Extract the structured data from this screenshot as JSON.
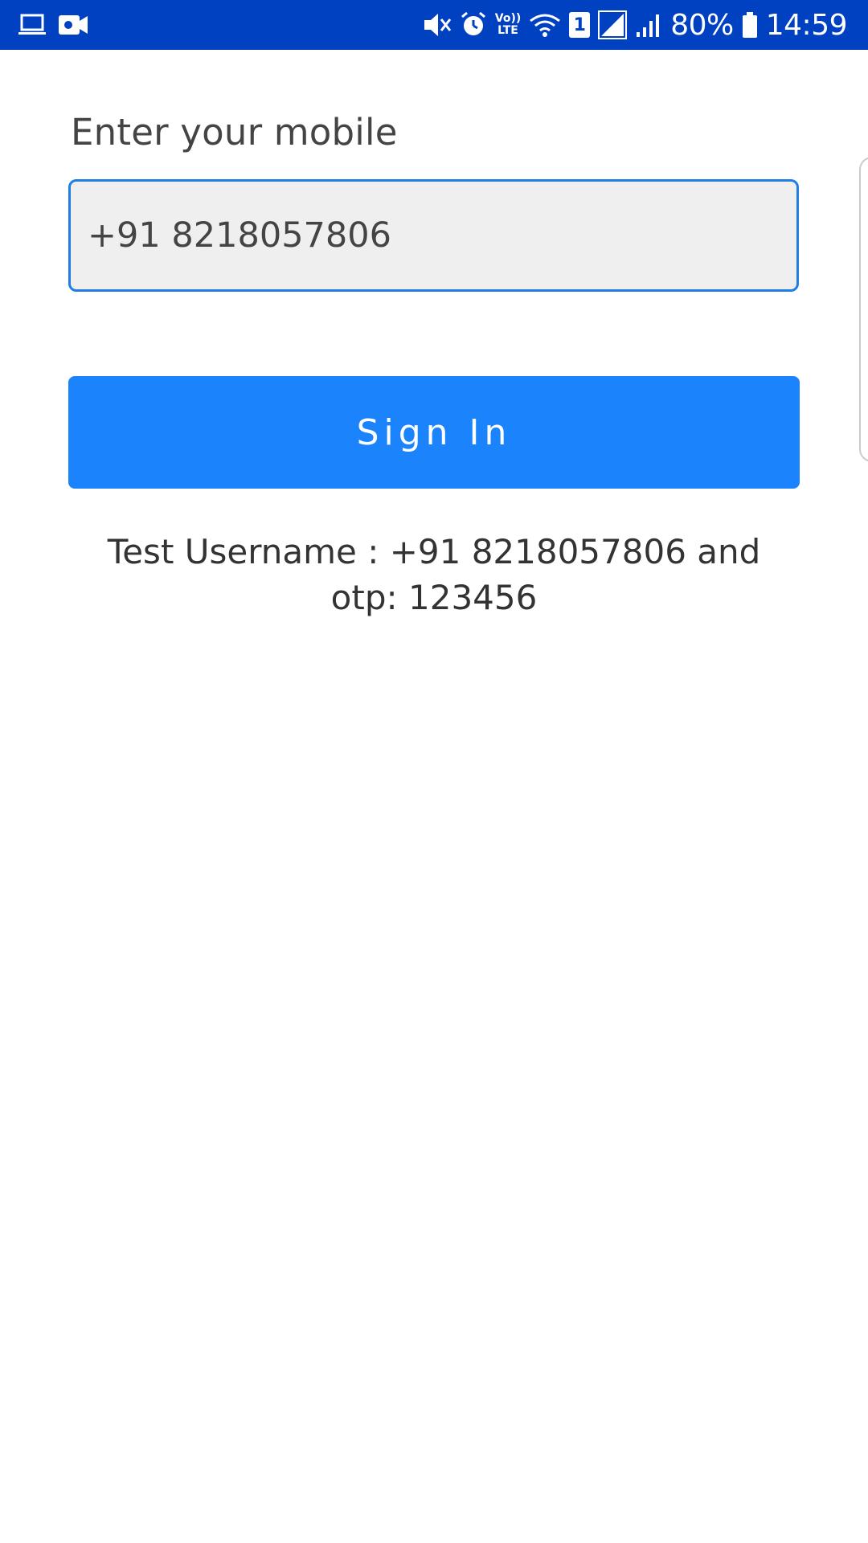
{
  "status_bar": {
    "battery_percent": "80%",
    "time": "14:59",
    "volte_top": "Vo))",
    "volte_bottom": "LTE",
    "sim_number": "1",
    "icons": {
      "left": [
        "laptop-icon",
        "video-camera-icon"
      ],
      "right": [
        "mute-icon",
        "alarm-icon",
        "volte-icon",
        "wifi-icon",
        "sim-icon",
        "signal-icon",
        "signal-icon",
        "battery-icon"
      ]
    },
    "colors": {
      "background": "#0041c2"
    }
  },
  "login": {
    "label": "Enter your mobile",
    "phone_value": "+91 8218057806",
    "signin_label": "Sign In",
    "hint_line1": "Test Username : +91 8218057806 and",
    "hint_line2": "otp: 123456"
  },
  "colors": {
    "primary": "#1b83fb",
    "input_border": "#1f7ee6",
    "input_background": "#efefef"
  }
}
